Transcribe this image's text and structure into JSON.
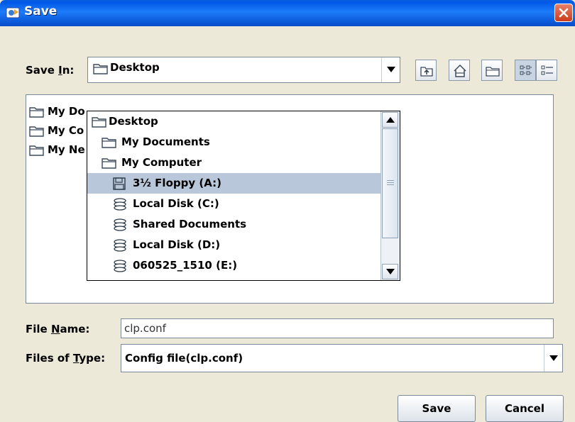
{
  "window": {
    "title": "Save"
  },
  "save_in": {
    "label_pre": "Save ",
    "label_mnemonic": "I",
    "label_post": "n:",
    "value": "Desktop"
  },
  "dropdown": {
    "items": [
      {
        "label": "Desktop",
        "icon": "folder-icon"
      },
      {
        "label": "My Documents",
        "icon": "folder-icon"
      },
      {
        "label": "My Computer",
        "icon": "folder-icon"
      },
      {
        "label": "3½ Floppy (A:)",
        "icon": "floppy-icon"
      },
      {
        "label": "Local Disk (C:)",
        "icon": "drive-icon"
      },
      {
        "label": "Shared Documents",
        "icon": "drive-icon"
      },
      {
        "label": "Local Disk (D:)",
        "icon": "drive-icon"
      },
      {
        "label": "060525_1510 (E:)",
        "icon": "drive-icon"
      }
    ],
    "selected_index": 3
  },
  "file_list": {
    "items": [
      {
        "label": "My Do"
      },
      {
        "label": "My Co"
      },
      {
        "label": "My Ne"
      }
    ]
  },
  "file_name": {
    "label_pre": "File ",
    "label_mnemonic": "N",
    "label_post": "ame:",
    "value": "clp.conf"
  },
  "file_type": {
    "label_pre": "Files of ",
    "label_mnemonic": "T",
    "label_post": "ype:",
    "value": "Config file(clp.conf)"
  },
  "buttons": {
    "save": "Save",
    "cancel": "Cancel"
  },
  "colors": {
    "title_bar": "#0058e6",
    "selection": "#b8c7d9",
    "close": "#cc3b1a"
  }
}
